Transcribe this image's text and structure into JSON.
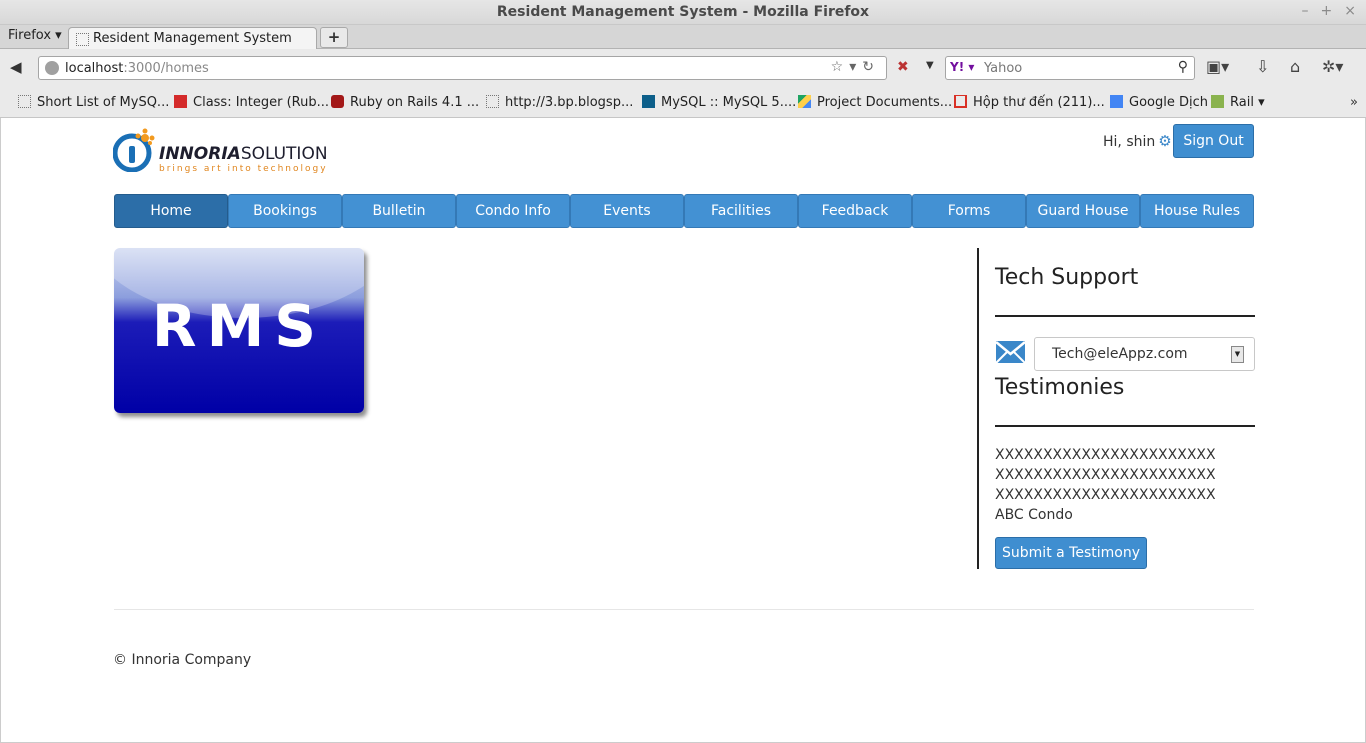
{
  "window": {
    "title": "Resident Management System - Mozilla Firefox"
  },
  "browser": {
    "menu_label": "Firefox",
    "tab_title": "Resident Management System",
    "url_host": "localhost",
    "url_rest": ":3000/homes",
    "search_engine": "Yahoo",
    "search_placeholder": "Yahoo",
    "bookmarks": [
      "Short List of MySQ...",
      "Class: Integer (Rub...",
      "Ruby on Rails 4.1 ...",
      "http://3.bp.blogsp...",
      "MySQL :: MySQL 5....",
      "Project Documents...",
      "Hộp thư đến (211)...",
      "Google Dịch",
      "Rail"
    ]
  },
  "header": {
    "brand_bold": "INNORIA",
    "brand_light": "SOLUTION",
    "tagline": "brings art into technology",
    "greeting": "Hi, shin",
    "sign_out": "Sign Out"
  },
  "nav": {
    "items": [
      "Home",
      "Bookings",
      "Bulletin",
      "Condo Info",
      "Events",
      "Facilities",
      "Feedback",
      "Forms",
      "Guard House",
      "House Rules"
    ],
    "active": "Home"
  },
  "hero": {
    "logo_text": "RMS"
  },
  "sidebar": {
    "tech_support_heading": "Tech Support",
    "tech_email": "Tech@eleAppz.com",
    "testimonies_heading": "Testimonies",
    "testimony_lines": [
      "XXXXXXXXXXXXXXXXXXXXXXX",
      "XXXXXXXXXXXXXXXXXXXXXXX",
      "XXXXXXXXXXXXXXXXXXXXXXX"
    ],
    "testimony_author": "ABC Condo",
    "submit_label": "Submit a Testimony"
  },
  "footer": {
    "copyright": "© Innoria Company"
  },
  "colors": {
    "primary": "#4391d3",
    "active": "#2c6ea8",
    "accent": "#e0861f"
  }
}
